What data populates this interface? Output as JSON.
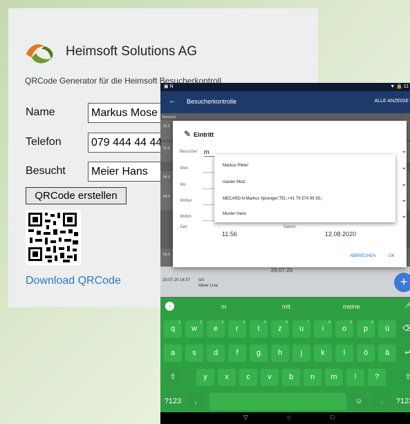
{
  "web": {
    "brand": "Heimsoft Solutions AG",
    "subtitle": "QRCode Generator für die Heimsoft Besucherkontroll",
    "fields": [
      {
        "label": "Name",
        "value": "Markus Mose"
      },
      {
        "label": "Telefon",
        "value": "079 444 44 44"
      },
      {
        "label": "Besucht",
        "value": "Meier Hans"
      }
    ],
    "qr_button": "QRCode erstellen",
    "download_link": "Download QRCode"
  },
  "tablet": {
    "status_right": "▼ 🔒 11",
    "appbar": {
      "back": "←",
      "title": "Besucherkontrolle",
      "all": "ALLE ANZEIGE"
    },
    "list_header": "Besuche",
    "rows": [
      "11.0",
      "11.0",
      "04.0",
      "04.0",
      "03.0"
    ],
    "date_header": "29.07.20",
    "entry": {
      "datetime": "29.07.20 14:37",
      "name1": "Ich",
      "name2": "Meier Lina"
    },
    "dialog": {
      "title": "Eintritt",
      "visitor_label": "Besucher",
      "visitor_value": "m",
      "wen_label": "Wen",
      "wo_label": "Wo",
      "woher_label": "Woher",
      "wohin_label": "Wohin",
      "zeit_label": "Zeit:",
      "datum_label": "Datum:",
      "time": "11:56",
      "date": "12.08.2020",
      "cancel": "ABBRECHEN",
      "ok": "OK"
    },
    "dropdown": [
      "Markus Pfeter",
      "master Mutz",
      "MECARD:N:Markus Sprenger;TEL:+41 79 574 99 35;;",
      "Muster Hans"
    ],
    "keyboard": {
      "suggestions": [
        "m",
        "mit",
        "meine"
      ],
      "row1": [
        "q",
        "w",
        "e",
        "r",
        "t",
        "z",
        "u",
        "i",
        "o",
        "p",
        "ü"
      ],
      "row1_sup": [
        "1",
        "2",
        "3",
        "4",
        "5",
        "6",
        "7",
        "8",
        "9",
        "0",
        ""
      ],
      "row2": [
        "a",
        "s",
        "d",
        "f",
        "g",
        "h",
        "j",
        "k",
        "l",
        "ö",
        "ä"
      ],
      "row3": [
        "y",
        "x",
        "c",
        "v",
        "b",
        "n",
        "m",
        "!",
        "?"
      ],
      "sym": "?123",
      "comma": ",",
      "period": ".",
      "sym_right": "?123",
      "emoji": "☺"
    }
  },
  "colors": {
    "appbar": "#1e3a6b",
    "keyboard": "#2ea043",
    "accent": "#3f78d6",
    "link": "#2a78c7"
  }
}
